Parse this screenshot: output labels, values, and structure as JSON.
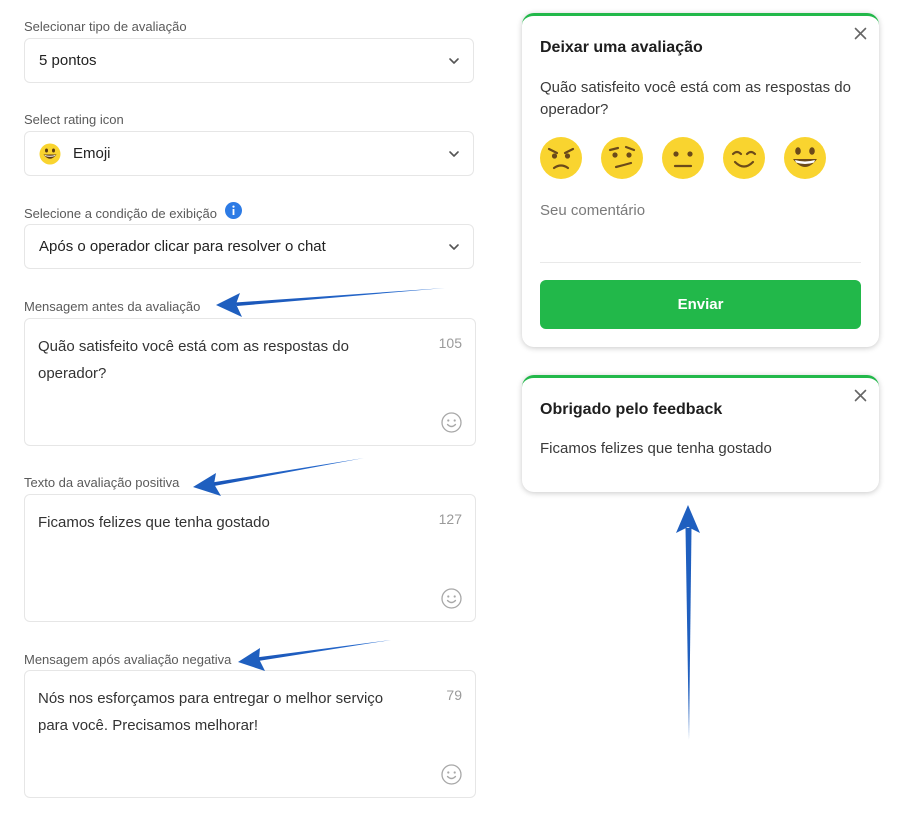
{
  "form": {
    "rating_type": {
      "label": "Selecionar tipo de avaliação",
      "value": "5 pontos"
    },
    "rating_icon": {
      "label": "Select rating icon",
      "value": "Emoji"
    },
    "display_condition": {
      "label": "Selecione a condição de exibição",
      "value": "Após o operador clicar para resolver o chat"
    },
    "message_before": {
      "label": "Mensagem antes da avaliação",
      "value": "Quão satisfeito você está com as respostas do operador?",
      "remaining": "105"
    },
    "positive_text": {
      "label": "Texto da avaliação positiva",
      "value": "Ficamos felizes que tenha gostado",
      "remaining": "127"
    },
    "negative_text": {
      "label": "Mensagem após avaliação negativa",
      "value": "Nós nos esforçamos para entregar o melhor serviço para você. Precisamos melhorar!",
      "remaining": "79"
    }
  },
  "rating_card": {
    "title": "Deixar uma avaliação",
    "question": "Quão satisfeito você está com as respostas do operador?",
    "faces": [
      "angry-face-icon",
      "smirk-face-icon",
      "neutral-face-icon",
      "smile-face-icon",
      "grin-face-icon"
    ],
    "comment_placeholder": "Seu comentário",
    "submit_label": "Enviar"
  },
  "thanks_card": {
    "title": "Obrigado pelo feedback",
    "message": "Ficamos felizes que tenha gostado"
  },
  "colors": {
    "accent_green": "#22b84a",
    "emoji_yellow": "#f9d42f",
    "annotation_arrow_blue": "#1f5fbf",
    "info_blue": "#2d7be5"
  }
}
